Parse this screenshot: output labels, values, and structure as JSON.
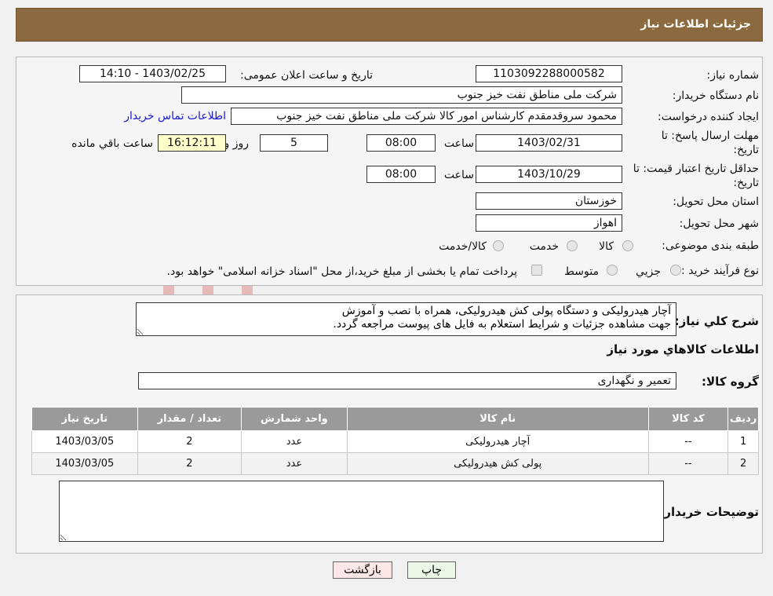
{
  "header": {
    "title": "جزئیات اطلاعات نیاز"
  },
  "form": {
    "need_number_label": "شماره نیاز:",
    "need_number": "1103092288000582",
    "announce_label": "تاریخ و ساعت اعلان عمومی:",
    "announce_value": "1403/02/25 - 14:10",
    "buyer_org_label": "نام دستگاه خریدار:",
    "buyer_org": "شرکت ملی مناطق نفت خیز جنوب",
    "creator_label": "ایجاد کننده درخواست:",
    "creator": "محمود سروقدمقدم کارشناس امور کالا شرکت ملی مناطق نفت خیز جنوب",
    "contact_link": "اطلاعات تماس خریدار",
    "deadline_label_1": "مهلت ارسال پاسخ: تا",
    "deadline_label_2": "تاریخ:",
    "deadline_date": "1403/02/31",
    "time_label": "ساعت",
    "deadline_time": "08:00",
    "days_value": "5",
    "days_label": "روز و",
    "remaining_time": "16:12:11",
    "remaining_label": "ساعت باقي مانده",
    "validity_label_1": "حداقل تاریخ اعتبار قیمت: تا",
    "validity_label_2": "تاریخ:",
    "validity_date": "1403/10/29",
    "validity_time": "08:00",
    "province_label": "استان محل تحویل:",
    "province": "خوزستان",
    "city_label": "شهر محل تحویل:",
    "city": "اهواز",
    "category_label": "طبقه بندی موضوعی:",
    "category_options": [
      "کالا",
      "خدمت",
      "کالا/خدمت"
    ],
    "purchase_type_label": "نوع فرآیند خرید :",
    "purchase_options": [
      "جزیي",
      "متوسط"
    ],
    "purchase_note": "پرداخت تمام یا بخشی از مبلغ خرید،از محل \"اسناد خزانه اسلامی\" خواهد بود."
  },
  "details": {
    "general_desc_label": "شرح کلي نياز:",
    "general_desc": "آچار هیدرولیکی و دستگاه پولی کش هیدرولیکی، همراه با نصب و آموزش\nجهت مشاهده جزئیات و شرایط استعلام به فایل های پیوست مراجعه گردد.",
    "goods_info_title": "اطلاعات کالاهاي مورد نياز",
    "goods_group_label": "گروه کالا:",
    "goods_group": "تعمیر و نگهداری",
    "table": {
      "headers": [
        "رديف",
        "کد کالا",
        "نام کالا",
        "واحد شمارش",
        "تعداد / مقدار",
        "تاريخ نياز"
      ],
      "rows": [
        [
          "1",
          "--",
          "آچار هیدرولیکی",
          "عدد",
          "2",
          "1403/03/05"
        ],
        [
          "2",
          "--",
          "پولی کش هیدرولیکی",
          "عدد",
          "2",
          "1403/03/05"
        ]
      ]
    },
    "buyer_notes_label": "توضیحات خریدار:",
    "buyer_notes": ""
  },
  "buttons": {
    "print": "چاپ",
    "back": "بازگشت"
  },
  "colors": {
    "header_bg": "#8b6a3f",
    "table_header_bg": "#9a9a9a",
    "print_btn_bg": "#eaf7e6",
    "back_btn_bg": "#fde6e6"
  }
}
